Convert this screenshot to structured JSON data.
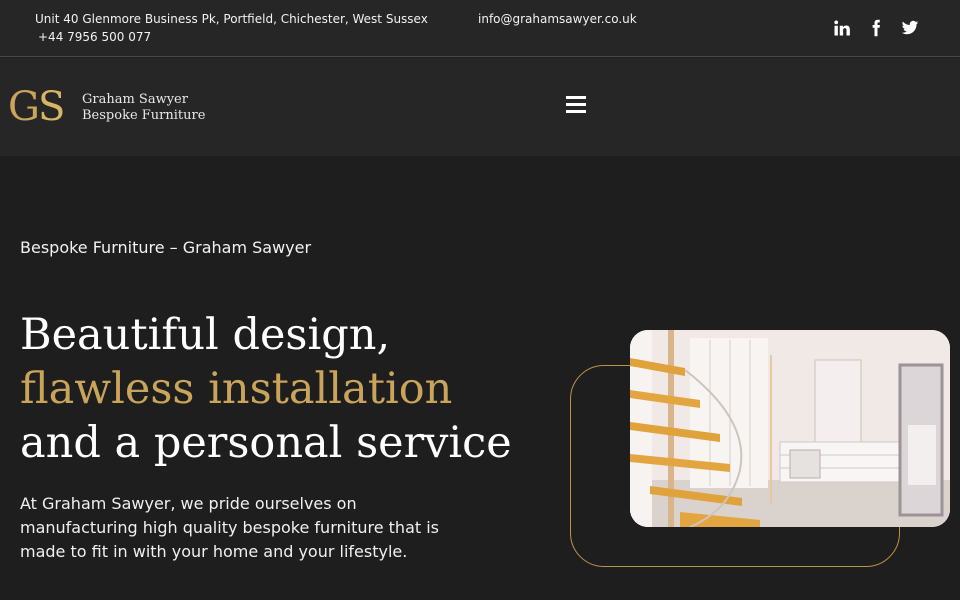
{
  "topbar": {
    "address": "Unit 40 Glenmore Business Pk, Portfield, Chichester, West Sussex",
    "phone": "+44 7956 500 077",
    "email": "info@grahamsawyer.co.uk",
    "social": [
      {
        "icon": "linkedin-icon",
        "label": "in"
      },
      {
        "icon": "facebook-icon",
        "label": "f"
      },
      {
        "icon": "twitter-icon",
        "label": "twitter"
      }
    ]
  },
  "header": {
    "logo_mark": "GS",
    "logo_line1": "Graham Sawyer",
    "logo_line2": "Bespoke Furniture",
    "menu_icon": "hamburger-menu-icon"
  },
  "hero": {
    "breadcrumb": "Bespoke Furniture – Graham Sawyer",
    "headline_line1": "Beautiful design,",
    "headline_line2": "flawless installation",
    "headline_line3": "and a personal service",
    "intro": "At Graham Sawyer, we pride ourselves on manufacturing high quality bespoke furniture that is made to fit in with your home and your lifestyle."
  },
  "colors": {
    "accent_gold": "#c9a45a",
    "background": "#1e1e1e",
    "bar": "#262626"
  }
}
